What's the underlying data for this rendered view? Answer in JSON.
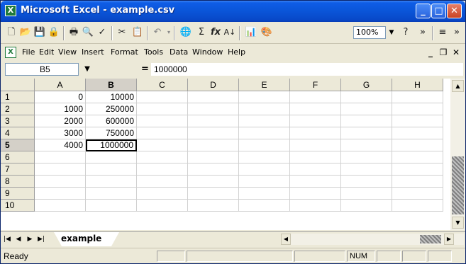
{
  "window": {
    "title": "Microsoft Excel - example.csv",
    "controls": {
      "minimize": "_",
      "maximize": "□",
      "close": "✕"
    }
  },
  "toolbar": {
    "zoom": "100%",
    "icons": [
      "new-icon",
      "open-icon",
      "save-icon",
      "permission-icon",
      "print-icon",
      "print-preview-icon",
      "spelling-icon",
      "cut-icon",
      "paste-icon",
      "undo-icon",
      "hyperlink-icon",
      "autosum-icon",
      "function-icon",
      "sort-ascending-icon",
      "chart-wizard-icon",
      "drawing-icon",
      "zoom-box",
      "help-icon",
      "more-icon",
      "align-icon"
    ]
  },
  "menu": {
    "items": [
      {
        "label": "File"
      },
      {
        "label": "Edit"
      },
      {
        "label": "View"
      },
      {
        "label": "Insert"
      },
      {
        "label": "Format"
      },
      {
        "label": "Tools"
      },
      {
        "label": "Data"
      },
      {
        "label": "Window"
      },
      {
        "label": "Help"
      }
    ],
    "mdi": {
      "minimize": "_",
      "restore": "❐",
      "close": "✕"
    }
  },
  "formula_bar": {
    "name_box": "B5",
    "equals": "=",
    "value": "1000000"
  },
  "grid": {
    "columns": [
      "A",
      "B",
      "C",
      "D",
      "E",
      "F",
      "G",
      "H"
    ],
    "active_column": "B",
    "rows": [
      "1",
      "2",
      "3",
      "4",
      "5",
      "6",
      "7",
      "8",
      "9",
      "10"
    ],
    "active_row": "5",
    "cells": [
      [
        "0",
        "10000"
      ],
      [
        "1000",
        "250000"
      ],
      [
        "2000",
        "600000"
      ],
      [
        "3000",
        "750000"
      ],
      [
        "4000",
        "1000000"
      ]
    ],
    "selected_cell": "B5"
  },
  "sheet_tabs": {
    "nav": [
      "|◀",
      "◀",
      "▶",
      "▶|"
    ],
    "active": "example"
  },
  "status_bar": {
    "status": "Ready",
    "indicators": [
      "NUM"
    ]
  }
}
